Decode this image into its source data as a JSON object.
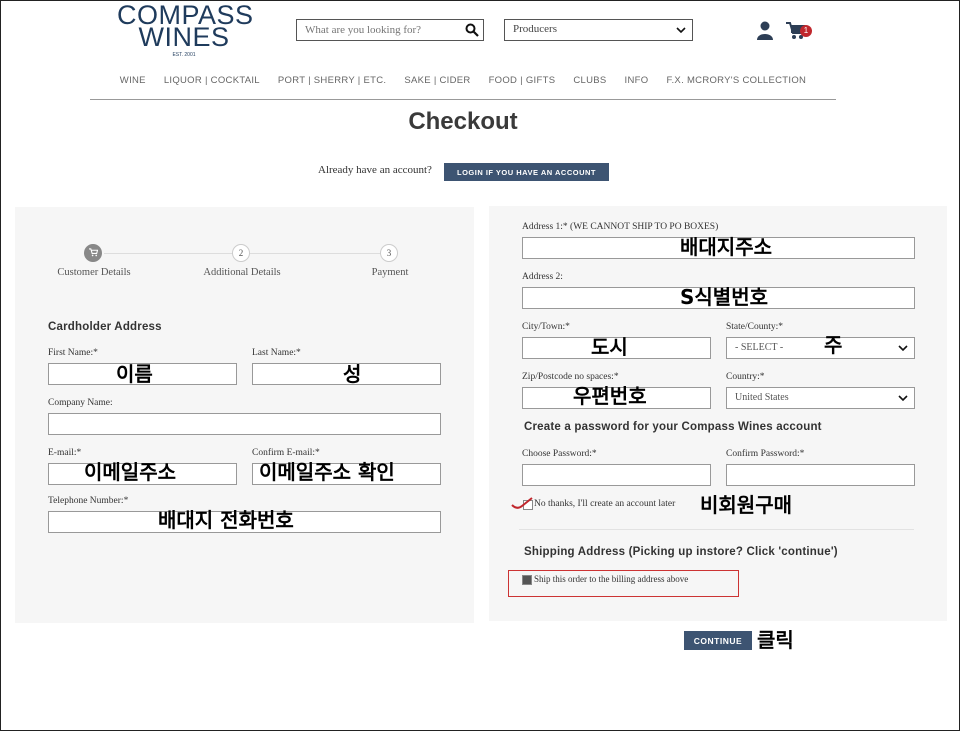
{
  "header": {
    "logo_line1": "COMPASS",
    "logo_line2": "WINES",
    "logo_est": "EST. 2001",
    "search_placeholder": "What are you looking for?",
    "producers_select": "Producers",
    "cart_count": "1"
  },
  "nav": [
    "WINE",
    "LIQUOR | COCKTAIL",
    "PORT | SHERRY | ETC.",
    "SAKE | CIDER",
    "FOOD | GIFTS",
    "CLUBS",
    "INFO",
    "F.X. MCRORY'S COLLECTION"
  ],
  "page": {
    "title": "Checkout",
    "already_text": "Already have an account?",
    "login_button": "LOGIN IF YOU HAVE AN ACCOUNT"
  },
  "steps": [
    {
      "label": "Customer Details",
      "num": ""
    },
    {
      "label": "Additional Details",
      "num": "2"
    },
    {
      "label": "Payment",
      "num": "3"
    }
  ],
  "cardholder": {
    "heading": "Cardholder Address",
    "first_name_label": "First Name:*",
    "first_name_note": "이름",
    "last_name_label": "Last Name:*",
    "last_name_note": "성",
    "company_label": "Company Name:",
    "email_label": "E-mail:*",
    "email_note": "이메일주소",
    "confirm_email_label": "Confirm E-mail:*",
    "confirm_email_note": "이메일주소 확인",
    "phone_label": "Telephone Number:*",
    "phone_note": "배대지 전화번호"
  },
  "address": {
    "address1_label": "Address 1:* (WE CANNOT SHIP TO PO BOXES)",
    "address1_note": "배대지주소",
    "address2_label": "Address 2:",
    "address2_note": "S식별번호",
    "city_label": "City/Town:*",
    "city_note": "도시",
    "state_label": "State/County:*",
    "state_value": "- SELECT -",
    "state_note": "주",
    "zip_label": "Zip/Postcode no spaces:*",
    "zip_note": "우편번호",
    "country_label": "Country:*",
    "country_value": "United States",
    "password_heading": "Create a password for your Compass Wines account",
    "choose_password_label": "Choose Password:*",
    "confirm_password_label": "Confirm Password:*",
    "no_thanks_label": "No thanks, I'll create an account later",
    "no_thanks_note": "비회원구매",
    "shipping_heading": "Shipping Address (Picking up instore? Click 'continue')",
    "ship_billing_label": "Ship this order to the billing address above",
    "continue_button": "CONTINUE",
    "continue_note": "클릭"
  },
  "colors": {
    "brand": "#1f3b5c",
    "button": "#3d5472",
    "annotation_box": "#cc3333"
  }
}
